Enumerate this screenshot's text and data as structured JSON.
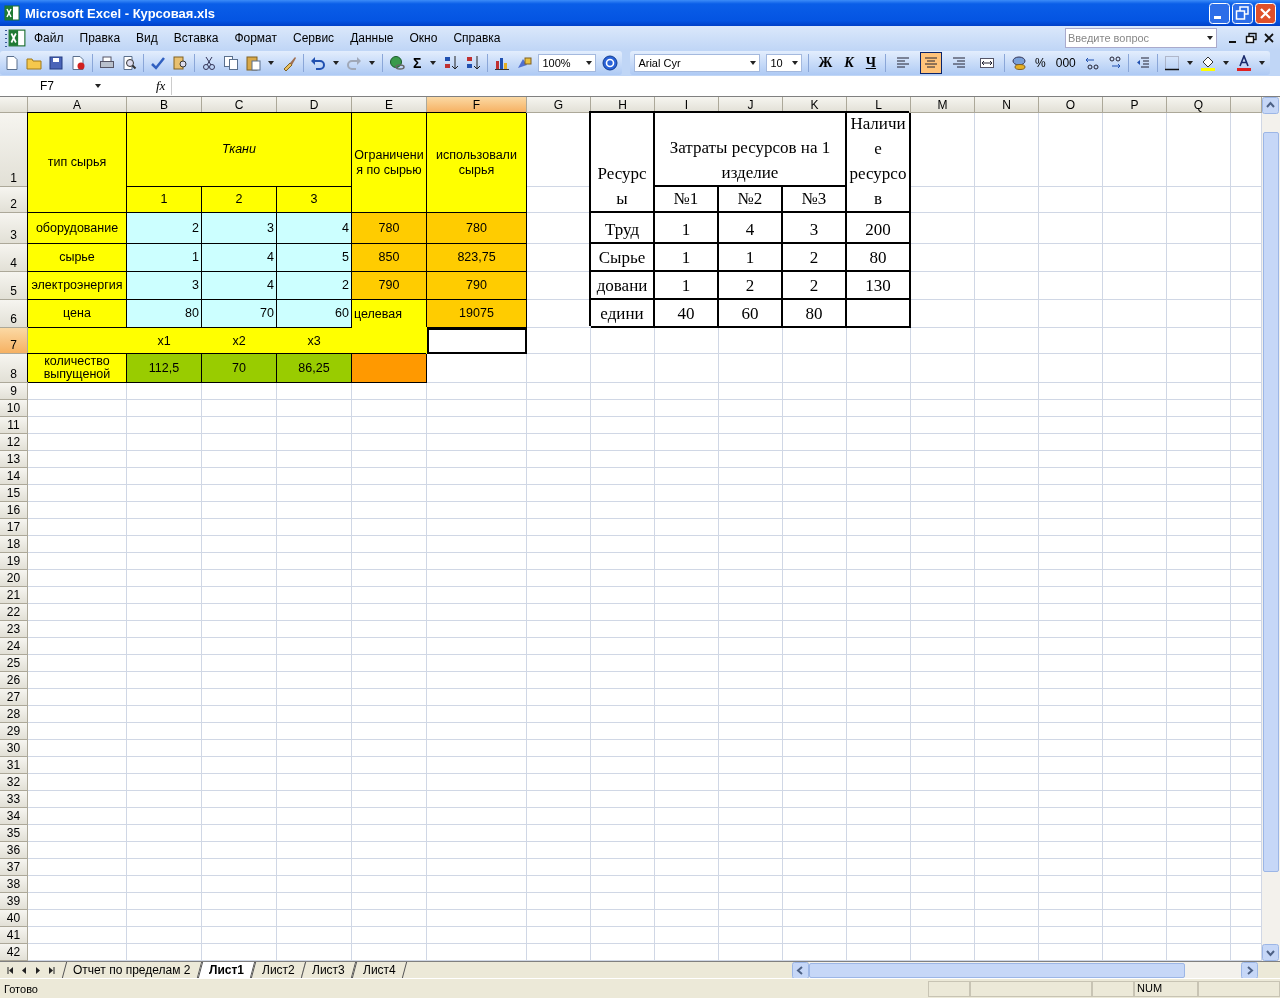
{
  "window": {
    "title": "Microsoft Excel - Курсовая.xls"
  },
  "menu": [
    "Файл",
    "Правка",
    "Вид",
    "Вставка",
    "Формат",
    "Сервис",
    "Данные",
    "Окно",
    "Справка"
  ],
  "help_search": {
    "placeholder": "Введите вопрос"
  },
  "toolbar": {
    "sum": "Σ",
    "zoom": "100%",
    "font": "Arial Cyr",
    "font_size": "10",
    "bold": "Ж",
    "italic": "К",
    "underline": "Ч",
    "percent": "%",
    "thousands": "000",
    "alignment": [
      {
        "kind": "left",
        "selected": false
      },
      {
        "kind": "center",
        "selected": true
      },
      {
        "kind": "right",
        "selected": false
      },
      {
        "kind": "merge",
        "selected": false
      }
    ]
  },
  "formula_bar": {
    "cell_ref": "F7",
    "function_label": "fx"
  },
  "sheet": {
    "columns": [
      {
        "label": "A",
        "selected": false
      },
      {
        "label": "B",
        "selected": false
      },
      {
        "label": "C",
        "selected": false
      },
      {
        "label": "D",
        "selected": false
      },
      {
        "label": "E",
        "selected": false
      },
      {
        "label": "F",
        "selected": true
      },
      {
        "label": "G",
        "selected": false
      },
      {
        "label": "H",
        "selected": false
      },
      {
        "label": "I",
        "selected": false
      },
      {
        "label": "J",
        "selected": false
      },
      {
        "label": "K",
        "selected": false
      },
      {
        "label": "L",
        "selected": false
      },
      {
        "label": "M",
        "selected": false
      },
      {
        "label": "N",
        "selected": false
      },
      {
        "label": "O",
        "selected": false
      },
      {
        "label": "P",
        "selected": false
      },
      {
        "label": "Q",
        "selected": false
      }
    ],
    "rows": [
      {
        "label": "1",
        "selected": false
      },
      {
        "label": "2",
        "selected": false
      },
      {
        "label": "3",
        "selected": false
      },
      {
        "label": "4",
        "selected": false
      },
      {
        "label": "5",
        "selected": false
      },
      {
        "label": "6",
        "selected": false
      },
      {
        "label": "7",
        "selected": true
      },
      {
        "label": "8",
        "selected": false
      },
      {
        "label": "9",
        "selected": false
      },
      {
        "label": "10",
        "selected": false
      },
      {
        "label": "11",
        "selected": false
      },
      {
        "label": "12",
        "selected": false
      },
      {
        "label": "13",
        "selected": false
      },
      {
        "label": "14",
        "selected": false
      },
      {
        "label": "15",
        "selected": false
      },
      {
        "label": "16",
        "selected": false
      },
      {
        "label": "17",
        "selected": false
      },
      {
        "label": "18",
        "selected": false
      },
      {
        "label": "19",
        "selected": false
      },
      {
        "label": "20",
        "selected": false
      },
      {
        "label": "21",
        "selected": false
      },
      {
        "label": "22",
        "selected": false
      },
      {
        "label": "23",
        "selected": false
      },
      {
        "label": "24",
        "selected": false
      },
      {
        "label": "25",
        "selected": false
      },
      {
        "label": "26",
        "selected": false
      },
      {
        "label": "27",
        "selected": false
      },
      {
        "label": "28",
        "selected": false
      },
      {
        "label": "29",
        "selected": false
      },
      {
        "label": "30",
        "selected": false
      },
      {
        "label": "31",
        "selected": false
      },
      {
        "label": "32",
        "selected": false
      },
      {
        "label": "33",
        "selected": false
      },
      {
        "label": "34",
        "selected": false
      },
      {
        "label": "35",
        "selected": false
      },
      {
        "label": "36",
        "selected": false
      },
      {
        "label": "37",
        "selected": false
      },
      {
        "label": "38",
        "selected": false
      },
      {
        "label": "39",
        "selected": false
      },
      {
        "label": "40",
        "selected": false
      },
      {
        "label": "41",
        "selected": false
      },
      {
        "label": "42",
        "selected": false
      }
    ],
    "materials_table": {
      "type_label": "тип сырья",
      "fabrics_label": "Ткани",
      "fabric_numbers": [
        "1",
        "2",
        "3"
      ],
      "limits_label": "Ограничения по сырью",
      "used_label": "использовали сырья",
      "rows": [
        {
          "name": "оборудование",
          "values": [
            "2",
            "3",
            "4"
          ],
          "limit": "780",
          "used": "780"
        },
        {
          "name": "сырье",
          "values": [
            "1",
            "4",
            "5"
          ],
          "limit": "850",
          "used": "823,75"
        },
        {
          "name": "электроэнергия",
          "values": [
            "3",
            "4",
            "2"
          ],
          "limit": "790",
          "used": "790"
        }
      ],
      "price_row": {
        "name": "цена",
        "values": [
          "80",
          "70",
          "60"
        ],
        "target_label": "целевая",
        "target_value": "19075"
      },
      "variables": [
        "x1",
        "x2",
        "x3"
      ],
      "quantity_row": {
        "name": "количество выпущеной",
        "values": [
          "112,5",
          "70",
          "86,25"
        ]
      }
    },
    "resources_table": {
      "resource_label": "Ресурсы",
      "cost_label": "Затраты ресурсов на 1 изделие",
      "product_labels": [
        "№1",
        "№2",
        "№3"
      ],
      "available_label": "Наличие ресурсов",
      "rows": [
        {
          "name": "Труд",
          "values": [
            "1",
            "4",
            "3"
          ],
          "available": "200"
        },
        {
          "name": "Сырье",
          "values": [
            "1",
            "1",
            "2"
          ],
          "available": "80"
        },
        {
          "name": "довани",
          "values": [
            "1",
            "2",
            "2"
          ],
          "available": "130"
        },
        {
          "name": "едини",
          "values": [
            "40",
            "60",
            "80"
          ]
        }
      ]
    }
  },
  "sheet_tabs": [
    {
      "label": "Отчет по пределам 2",
      "selected": false
    },
    {
      "label": "Лист1",
      "selected": true
    },
    {
      "label": "Лист2",
      "selected": false
    },
    {
      "label": "Лист3",
      "selected": false
    },
    {
      "label": "Лист4",
      "selected": false
    }
  ],
  "status_bar": {
    "text": "Готово",
    "indicator": "NUM"
  }
}
